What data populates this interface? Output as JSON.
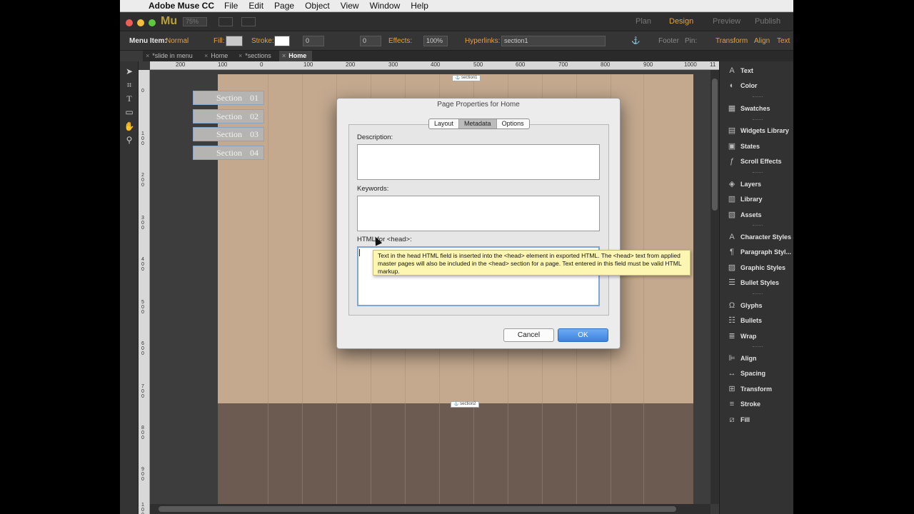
{
  "menubar": {
    "app_name": "Adobe Muse CC",
    "items": [
      "File",
      "Edit",
      "Page",
      "Object",
      "View",
      "Window",
      "Help"
    ]
  },
  "appbar": {
    "logo": "Mu",
    "zoom": "75%",
    "modes": [
      "Plan",
      "Design",
      "Preview",
      "Publish"
    ],
    "active_mode": "Design"
  },
  "controlbar": {
    "menu_item_label": "Menu Item:",
    "menu_item_state": "Normal",
    "fill_label": "Fill:",
    "stroke_label": "Stroke:",
    "stroke_value": "0",
    "corner_value": "0",
    "effects_label": "Effects:",
    "opacity_value": "100%",
    "hyperlinks_label": "Hyperlinks:",
    "hyperlink_value": "section1",
    "footer_label": "Footer",
    "pin_label": "Pin:",
    "transform_label": "Transform",
    "align_label": "Align",
    "text_label": "Text"
  },
  "doctabs": [
    "*slide in menu",
    "Home",
    "*sections",
    "Home"
  ],
  "ruler_top": [
    "200",
    "100",
    "0",
    "100",
    "200",
    "300",
    "400",
    "500",
    "600",
    "700",
    "800",
    "900",
    "1000",
    "11"
  ],
  "ruler_left": [
    "0",
    "100",
    "200",
    "300",
    "400",
    "500",
    "600",
    "700",
    "800",
    "900",
    "100"
  ],
  "canvas": {
    "anchor1": "section1",
    "anchor2": "section2",
    "menu_buttons": [
      {
        "label": "Section",
        "num": "01"
      },
      {
        "label": "Section",
        "num": "02"
      },
      {
        "label": "Section",
        "num": "03"
      },
      {
        "label": "Section",
        "num": "04"
      }
    ],
    "colors": {
      "page_top": "#c4a98f",
      "page_bottom": "#6b5b50",
      "menu_button": "#b6b4b2"
    }
  },
  "panels": [
    "Text",
    "Color",
    "Swatches",
    "Widgets Library",
    "States",
    "Scroll Effects",
    "Layers",
    "Library",
    "Assets",
    "Character Styles",
    "Paragraph Styl...",
    "Graphic Styles",
    "Bullet Styles",
    "Glyphs",
    "Bullets",
    "Wrap",
    "Align",
    "Spacing",
    "Transform",
    "Stroke",
    "Fill"
  ],
  "dialog": {
    "title": "Page Properties for Home",
    "tabs": [
      "Layout",
      "Metadata",
      "Options"
    ],
    "selected_tab": "Metadata",
    "description_label": "Description:",
    "description_value": "",
    "keywords_label": "Keywords:",
    "keywords_value": "",
    "head_html_label": "HTML for <head>:",
    "head_html_value": "",
    "cancel_label": "Cancel",
    "ok_label": "OK"
  },
  "tooltip": "Text in the head HTML field is inserted into the <head> element in exported HTML. The <head> text from applied master pages will also be included in the <head> section for a page. Text entered in this field must be valid HTML markup."
}
